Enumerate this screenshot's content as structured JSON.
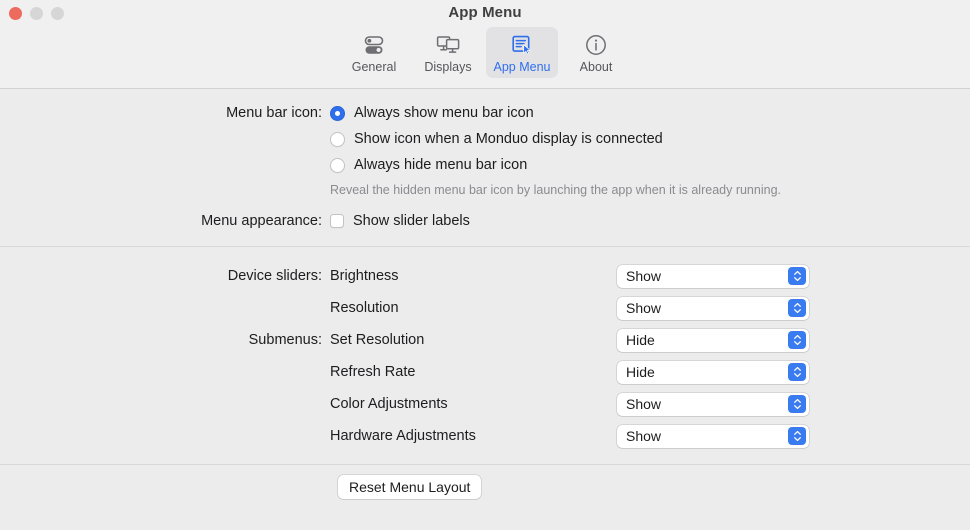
{
  "window": {
    "title": "App Menu",
    "traffic_lights": [
      {
        "name": "close",
        "color": "#ed6a5e"
      },
      {
        "name": "minimize",
        "color": "#d6d6d6"
      },
      {
        "name": "zoom",
        "color": "#d6d6d6"
      }
    ]
  },
  "toolbar": {
    "tabs": [
      {
        "label": "General",
        "icon": "toggles-icon",
        "selected": false
      },
      {
        "label": "Displays",
        "icon": "displays-icon",
        "selected": false
      },
      {
        "label": "App Menu",
        "icon": "app-menu-icon",
        "selected": true
      },
      {
        "label": "About",
        "icon": "info-icon",
        "selected": false
      }
    ],
    "accent_color": "#2f6fec",
    "selected_tab_background": "#e2e2e4"
  },
  "menu_bar_icon": {
    "label": "Menu bar icon:",
    "options": [
      {
        "label": "Always show menu bar icon",
        "selected": true
      },
      {
        "label": "Show icon when a Monduo display is connected",
        "selected": false
      },
      {
        "label": "Always hide menu bar icon",
        "selected": false
      }
    ],
    "hint": "Reveal the hidden menu bar icon by launching the app when it is already running."
  },
  "menu_appearance": {
    "label": "Menu appearance:",
    "checkbox": {
      "label": "Show slider labels",
      "checked": false
    }
  },
  "device_sliders": {
    "label": "Device sliders:",
    "rows": [
      {
        "name": "Brightness",
        "value": "Show"
      },
      {
        "name": "Resolution",
        "value": "Show"
      }
    ]
  },
  "submenus": {
    "label": "Submenus:",
    "rows": [
      {
        "name": "Set Resolution",
        "value": "Hide"
      },
      {
        "name": "Refresh Rate",
        "value": "Hide"
      },
      {
        "name": "Color Adjustments",
        "value": "Show"
      },
      {
        "name": "Hardware Adjustments",
        "value": "Show"
      }
    ]
  },
  "select_options": [
    "Show",
    "Hide"
  ],
  "footer": {
    "reset_label": "Reset Menu Layout"
  }
}
